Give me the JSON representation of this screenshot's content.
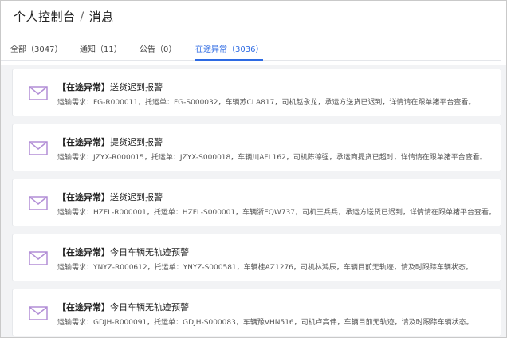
{
  "breadcrumb": {
    "root": "个人控制台",
    "separator": "/",
    "current": "消息"
  },
  "tabs": [
    {
      "label": "全部（3047）"
    },
    {
      "label": "通知（11）"
    },
    {
      "label": "公告（0）"
    },
    {
      "label": "在途异常（3036）"
    }
  ],
  "active_tab": "在途异常（3036）",
  "accent_color": "#2d6ae3",
  "icon_color": "#b28ed6",
  "messages": [
    {
      "icon": "mail-icon",
      "tag": "【在途异常】",
      "subject": "送货迟到报警",
      "body": "运输需求：FG-R000011，托运单：FG-S000032，车辆苏CLA817，司机赵永龙，承运方送货已迟到，详情请在跟单猪平台查看。"
    },
    {
      "icon": "mail-icon",
      "tag": "【在途异常】",
      "subject": "提货迟到报警",
      "body": "运输需求：JZYX-R000015，托运单：JZYX-S000018，车辆川AFL162，司机陈德强，承运商提货已超时，详情请在跟单猪平台查看。"
    },
    {
      "icon": "mail-icon",
      "tag": "【在途异常】",
      "subject": "送货迟到报警",
      "body": "运输需求：HZFL-R000001，托运单：HZFL-S000001，车辆浙EQW737，司机王兵兵，承运方送货已迟到，详情请在跟单猪平台查看。"
    },
    {
      "icon": "mail-icon",
      "tag": "【在途异常】",
      "subject": "今日车辆无轨迹预警",
      "body": "运输需求：YNYZ-R000612，托运单：YNYZ-S000581，车辆桂AZ1276，司机林鸿辰，车辆目前无轨迹，请及时跟踪车辆状态。"
    },
    {
      "icon": "mail-icon",
      "tag": "【在途异常】",
      "subject": "今日车辆无轨迹预警",
      "body": "运输需求：GDJH-R000091，托运单：GDJH-S000083，车辆豫VHN516，司机卢高伟，车辆目前无轨迹，请及时跟踪车辆状态。"
    }
  ]
}
